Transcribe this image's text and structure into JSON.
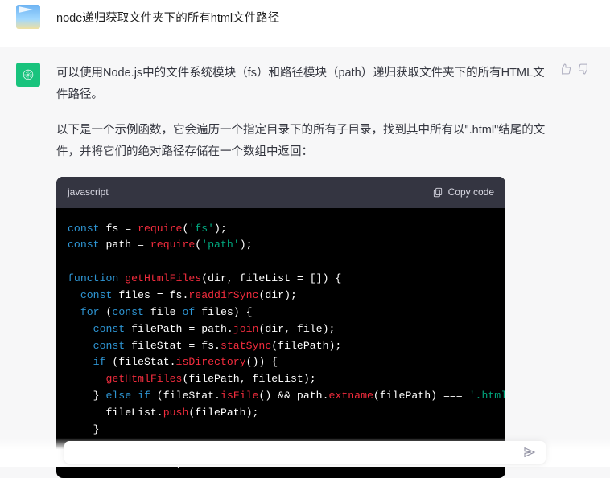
{
  "user": {
    "message": "node递归获取文件夹下的所有html文件路径"
  },
  "assistant": {
    "paragraph1": "可以使用Node.js中的文件系统模块（fs）和路径模块（path）递归获取文件夹下的所有HTML文件路径。",
    "paragraph2": "以下是一个示例函数，它会遍历一个指定目录下的所有子目录，找到其中所有以\".html\"结尾的文件，并将它们的绝对路径存储在一个数组中返回：",
    "codeblock": {
      "language": "javascript",
      "copy_label": "Copy code",
      "code_plain": "const fs = require('fs');\nconst path = require('path');\n\nfunction getHtmlFiles(dir, fileList = []) {\n  const files = fs.readdirSync(dir);\n  for (const file of files) {\n    const filePath = path.join(dir, file);\n    const fileStat = fs.statSync(filePath);\n    if (fileStat.isDirectory()) {\n      getHtmlFiles(filePath, fileList);\n    } else if (fileStat.isFile() && path.extname(filePath) === '.html') {\n      fileList.push(filePath);\n    }\n  }\n  return fileList;"
    }
  },
  "feedback": {
    "thumbs_up": "thumbs-up",
    "thumbs_down": "thumbs-down"
  },
  "input": {
    "placeholder": ""
  }
}
